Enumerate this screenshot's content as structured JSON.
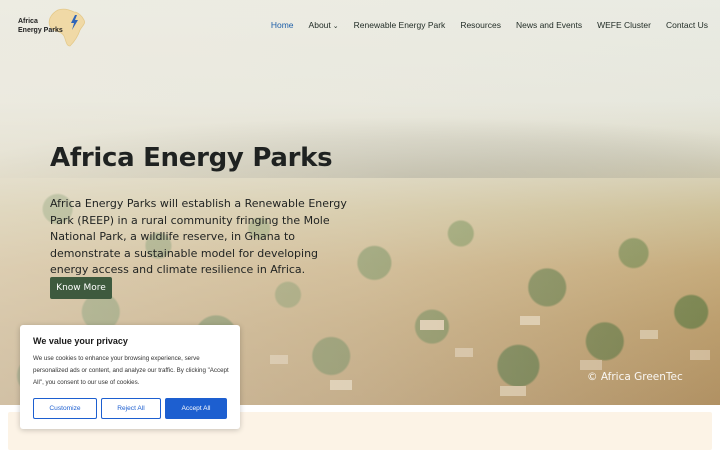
{
  "brand": {
    "logo_line1": "Africa",
    "logo_line2": "Energy Parks",
    "logo_icon": "africa-map-lightning-icon",
    "accent_color": "#1d5fa8"
  },
  "nav": {
    "items": [
      {
        "label": "Home",
        "active": true
      },
      {
        "label": "About",
        "dropdown": true
      },
      {
        "label": "Renewable Energy Park"
      },
      {
        "label": "Resources"
      },
      {
        "label": "News and Events"
      },
      {
        "label": "WEFE Cluster"
      },
      {
        "label": "Contact Us"
      }
    ]
  },
  "hero": {
    "title": "Africa Energy Parks",
    "description": "Africa Energy Parks will establish a Renewable Energy Park (REEP) in a rural community fringing the Mole National Park, a wildlife reserve, in Ghana to demonstrate a sustainable model for developing energy access and climate resilience in Africa.",
    "cta_label": "Know More",
    "cta_color": "#3e5a3e",
    "image_credit": "© Africa GreenTec"
  },
  "cookie_banner": {
    "title": "We value your privacy",
    "text": "We use cookies to enhance your browsing experience, serve personalized ads or content, and analyze our traffic. By clicking \"Accept All\", you consent to our use of cookies.",
    "customize_label": "Customize",
    "reject_label": "Reject All",
    "accept_label": "Accept All",
    "button_color": "#1d5fd0"
  }
}
